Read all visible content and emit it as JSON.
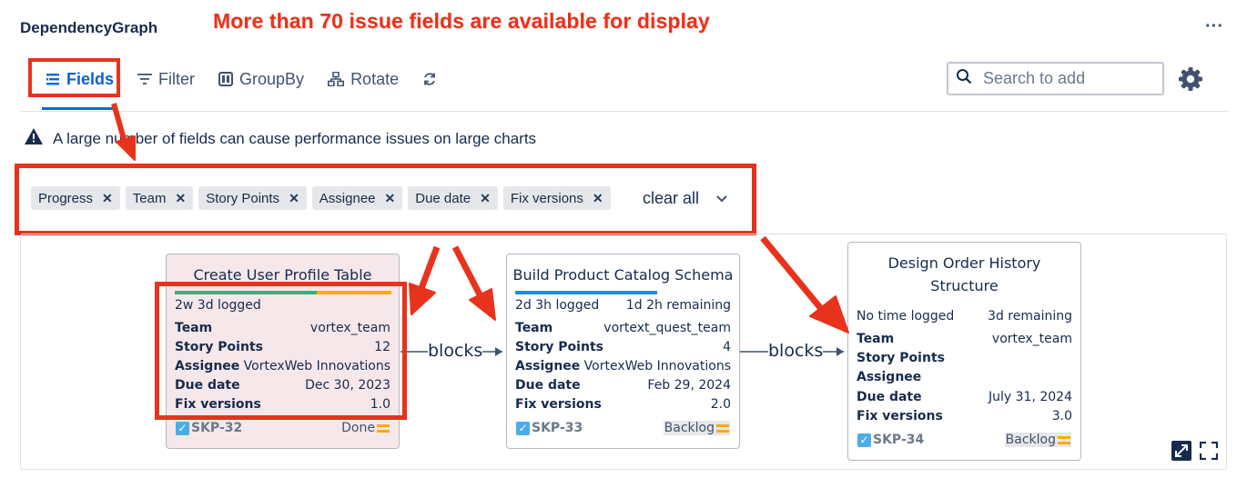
{
  "app": {
    "title": "DependencyGraph"
  },
  "annotation": {
    "headline": "More than 70 issue fields are available for display"
  },
  "tabs": [
    {
      "label": "Fields",
      "icon": "fields-icon"
    },
    {
      "label": "Filter",
      "icon": "filter-icon"
    },
    {
      "label": "GroupBy",
      "icon": "groupby-icon"
    },
    {
      "label": "Rotate",
      "icon": "rotate-icon"
    }
  ],
  "search": {
    "placeholder": "Search to add"
  },
  "warning": {
    "text": "A large number of fields can cause performance issues on large charts"
  },
  "selected_fields": [
    "Progress",
    "Team",
    "Story Points",
    "Assignee",
    "Due date",
    "Fix versions"
  ],
  "clear_all_label": "clear all",
  "colors": {
    "accent": "#0c66e4",
    "annotation_red": "#e8321b",
    "done_green": "#36b37e",
    "progress_orange": "#ffab00",
    "in_progress_blue": "#2684ff"
  },
  "field_labels": {
    "team": "Team",
    "story_points": "Story Points",
    "assignee": "Assignee",
    "due_date": "Due date",
    "fix_versions": "Fix versions"
  },
  "edges": [
    {
      "label": "blocks"
    },
    {
      "label": "blocks"
    }
  ],
  "cards": [
    {
      "title": "Create User Profile Table",
      "logged": "2w 3d logged",
      "remaining": "",
      "team": "vortex_team",
      "story_points": "12",
      "assignee": "VortexWeb Innovations",
      "due_date": "Dec 30, 2023",
      "fix_versions": "1.0",
      "key": "SKP-32",
      "status": "Done",
      "progress": {
        "done": 0.65,
        "remaining": 0.35
      }
    },
    {
      "title": "Build Product Catalog Schema",
      "logged": "2d 3h logged",
      "remaining": "1d 2h remaining",
      "team": "vortext_quest_team",
      "story_points": "4",
      "assignee": "VortexWeb Innovations",
      "due_date": "Feb 29, 2024",
      "fix_versions": "2.0",
      "key": "SKP-33",
      "status": "Backlog",
      "progress": {
        "logged": 0.66
      }
    },
    {
      "title": "Design Order History Structure",
      "title_line1": "Design Order History",
      "title_line2": "Structure",
      "logged": "No time logged",
      "remaining": "3d remaining",
      "team": "vortex_team",
      "story_points": "",
      "assignee": "",
      "due_date": "July 31, 2024",
      "fix_versions": "3.0",
      "key": "SKP-34",
      "status": "Backlog"
    }
  ],
  "controls": [
    {
      "icon": "expand-icon"
    },
    {
      "icon": "fullscreen-icon"
    }
  ]
}
